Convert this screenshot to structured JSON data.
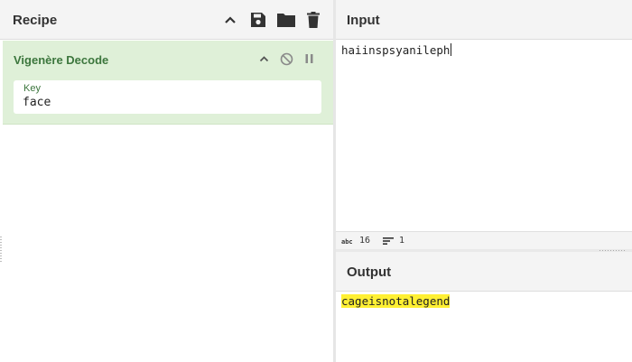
{
  "recipe": {
    "title": "Recipe",
    "icons": [
      "chevron-up-icon",
      "save-icon",
      "folder-icon",
      "trash-icon"
    ],
    "operation": {
      "name": "Vigenère Decode",
      "icons": [
        "chevron-up-icon",
        "disable-icon",
        "pause-icon"
      ],
      "args": [
        {
          "label": "Key",
          "value": "face"
        }
      ]
    }
  },
  "input": {
    "title": "Input",
    "text": "haiinspsyanileph"
  },
  "status": {
    "length": "16",
    "lines": "1"
  },
  "output": {
    "title": "Output",
    "text": "cageisnotalegend"
  },
  "colors": {
    "op_background": "#dff0d8",
    "op_text": "#3c763d",
    "highlight": "#fff033",
    "header_background": "#f4f4f4"
  }
}
